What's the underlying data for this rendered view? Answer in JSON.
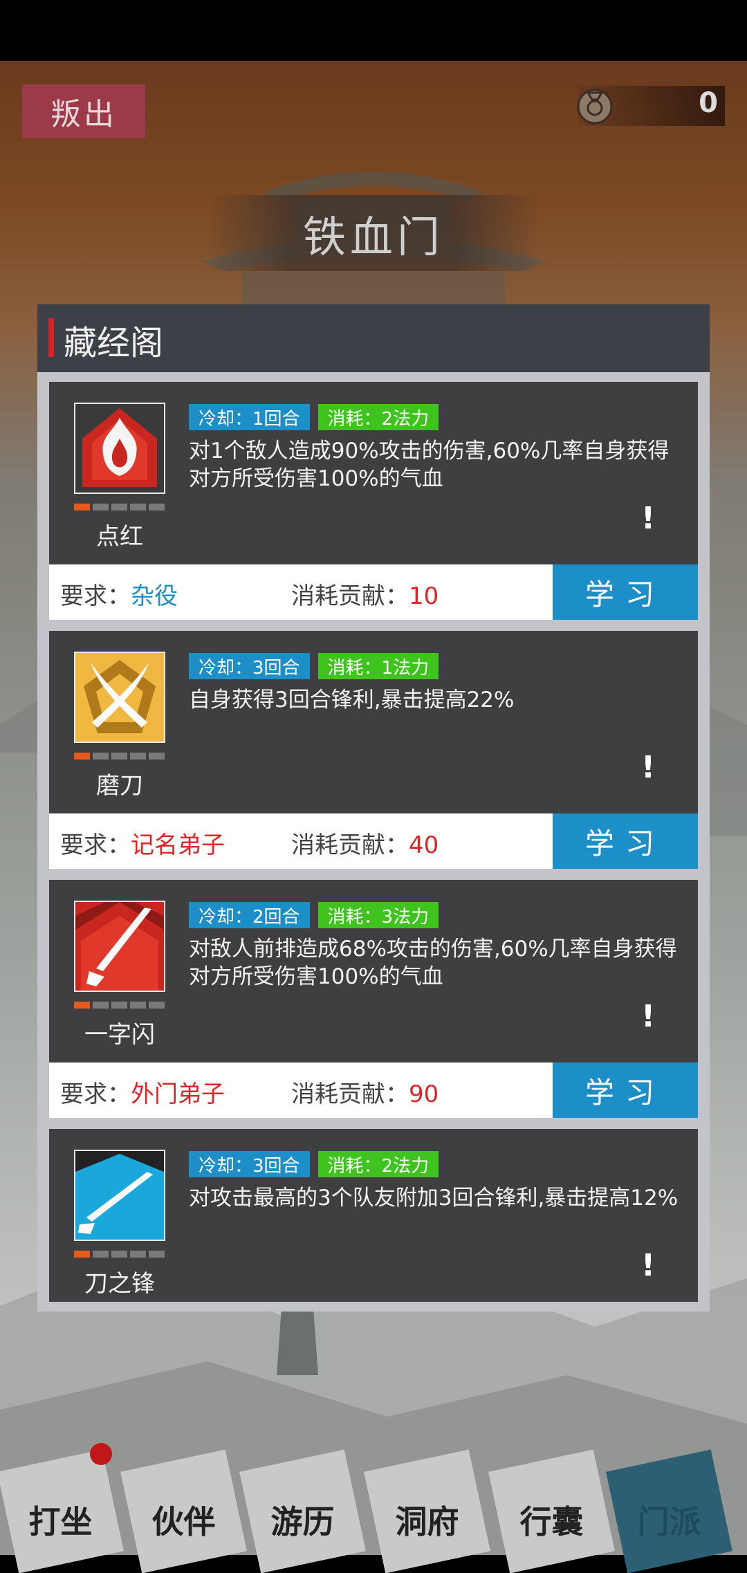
{
  "top": {
    "betray_label": "叛出",
    "currency_value": "0",
    "currency_icon": "coin-pouch-icon"
  },
  "sect": {
    "name": "铁血门"
  },
  "panel": {
    "title": "藏经阁"
  },
  "labels": {
    "require": "要求：",
    "contribution": "消耗贡献：",
    "learn": "学习",
    "info": "!"
  },
  "skills": [
    {
      "name": "点红",
      "icon": "flame-icon",
      "cooldown": "冷却：1回合",
      "cost": "消耗：2法力",
      "desc": "对1个敌人造成90%攻击的伤害,60%几率自身获得对方所受伤害100%的气血",
      "level": 1,
      "requirement": "杂役",
      "requirement_color": "#1c8fc9",
      "contribution": "10"
    },
    {
      "name": "磨刀",
      "icon": "crossed-blades-icon",
      "cooldown": "冷却：3回合",
      "cost": "消耗：1法力",
      "desc": "自身获得3回合锋利,暴击提高22%",
      "level": 1,
      "requirement": "记名弟子",
      "requirement_color": "#e02424",
      "contribution": "40"
    },
    {
      "name": "一字闪",
      "icon": "sword-slash-icon",
      "cooldown": "冷却：2回合",
      "cost": "消耗：3法力",
      "desc": "对敌人前排造成68%攻击的伤害,60%几率自身获得对方所受伤害100%的气血",
      "level": 1,
      "requirement": "外门弟子",
      "requirement_color": "#e02424",
      "contribution": "90"
    },
    {
      "name": "刀之锋",
      "icon": "blade-edge-icon",
      "cooldown": "冷却：3回合",
      "cost": "消耗：2法力",
      "desc": "对攻击最高的3个队友附加3回合锋利,暴击提高12%",
      "level": 1
    }
  ],
  "nav": [
    {
      "label": "打坐",
      "icon": "meditate-icon",
      "active": false
    },
    {
      "label": "伙伴",
      "icon": "partner-icon",
      "active": false
    },
    {
      "label": "游历",
      "icon": "travel-icon",
      "active": false
    },
    {
      "label": "洞府",
      "icon": "cave-icon",
      "active": false
    },
    {
      "label": "行囊",
      "icon": "bag-icon",
      "active": false
    },
    {
      "label": "门派",
      "icon": "sect-icon",
      "active": true
    }
  ]
}
